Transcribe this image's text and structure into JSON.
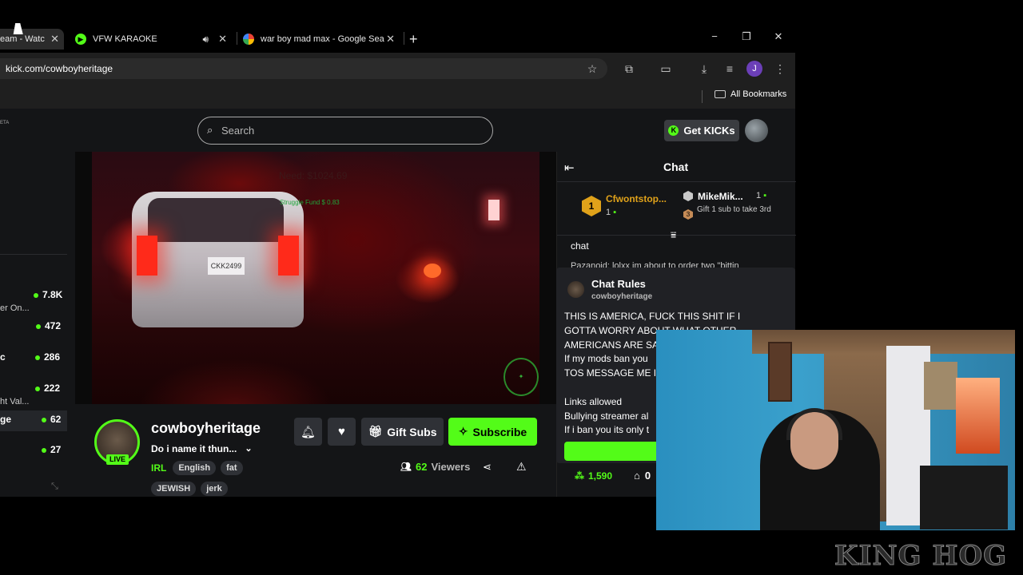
{
  "browser": {
    "tabs": [
      {
        "title": "eam - Watc",
        "active": true
      },
      {
        "title": "VFW KARAOKE",
        "audio": true
      },
      {
        "title": "war boy mad max - Google Sea"
      }
    ],
    "new_tab": "+",
    "window": {
      "minimize": "−",
      "restore": "❐",
      "close": "✕"
    },
    "url": "kick.com/cowboyheritage",
    "bookmarks_label": "All Bookmarks",
    "profile_initial": "J"
  },
  "kick": {
    "search_placeholder": "Search",
    "get_kicks": "Get KICKs",
    "sidebar": [
      {
        "label": "",
        "viewers": "7.8K"
      },
      {
        "label": "er On...",
        "viewers": ""
      },
      {
        "label": "",
        "viewers": "472"
      },
      {
        "label": "c",
        "viewers": "286"
      },
      {
        "label": "",
        "viewers": "222"
      },
      {
        "label": "ht Val...",
        "viewers": ""
      },
      {
        "label": "ge",
        "viewers": "62"
      },
      {
        "label": "",
        "viewers": "27"
      }
    ],
    "video": {
      "overlay_need": "Need: $1024.69",
      "overlay_fund": "Struggle Fund $ 0.83",
      "plate": "CKK2499"
    },
    "stream": {
      "username": "cowboyheritage",
      "title": "Do i name it thun...",
      "live": "LIVE",
      "category": "IRL",
      "tags": [
        "English",
        "fat",
        "JEWISH",
        "jerk"
      ],
      "viewers_count": "62",
      "viewers_label": "Viewers",
      "gift_subs": "Gift Subs",
      "subscribe": "Subscribe"
    },
    "chat": {
      "header": "Chat",
      "leader1": {
        "rank": "1",
        "name": "Cfwontstop...",
        "count": "1"
      },
      "leader2": {
        "name": "MikeMik...",
        "count": "1",
        "rank": "3",
        "note": "Gift 1 sub to take 3rd"
      },
      "message_preview": "chat",
      "partial_line": "Pazanoid: lolxx im about to order two \"bittin",
      "rules_title": "Chat Rules",
      "rules_owner": "cowboyheritage",
      "rules_lines": [
        "THIS IS AMERICA, FUCK THIS SHIT IF I",
        "GOTTA WORRY ABOUT WHAT OTHER",
        "AMERICANS ARE SA",
        "If my mods ban you",
        "TOS MESSAGE ME I",
        "",
        "Links allowed",
        "Bullying streamer al",
        "If i ban you its only t"
      ],
      "kicks_balance": "1,590",
      "store_count": "0"
    }
  },
  "overlay": {
    "watermark": "KING HOG"
  },
  "colors": {
    "accent": "#53fc18",
    "bg": "#141517",
    "panel": "#202125"
  }
}
